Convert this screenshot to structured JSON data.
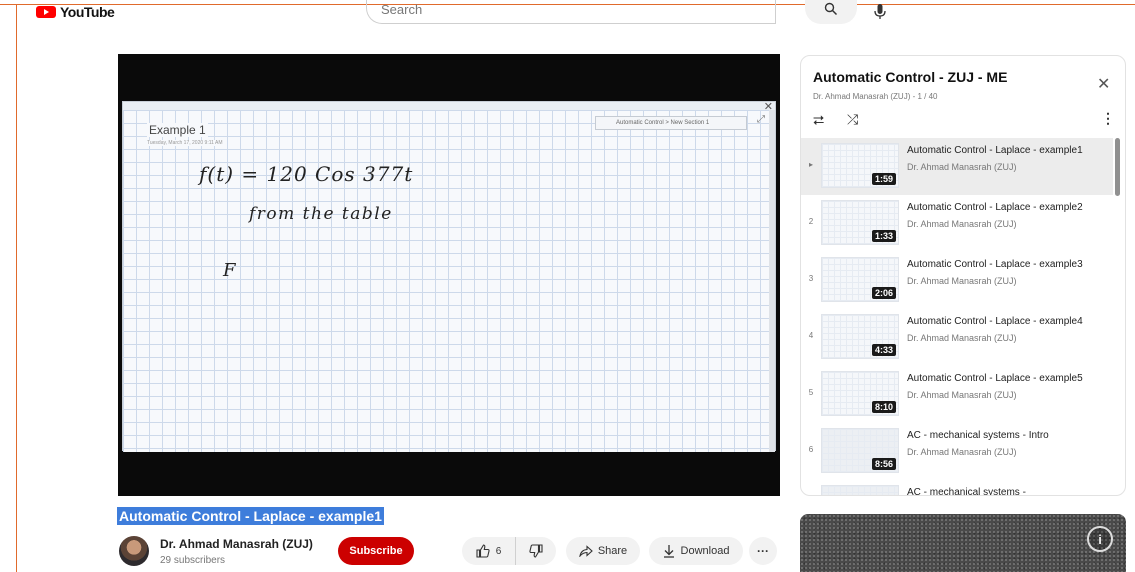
{
  "header": {
    "logo_text": "YouTube",
    "search_placeholder": "Search"
  },
  "player": {
    "note_title": "Example 1",
    "note_date": "Tuesday, March 17, 2020  9:11 AM",
    "section_label": "Automatic Control > New Section 1",
    "handwriting_line1": "f(t) = 120 Cos 377t",
    "handwriting_line2": "from the table",
    "handwriting_line3": "F"
  },
  "video": {
    "title": "Automatic Control - Laplace - example1",
    "channel_name": "Dr. Ahmad Manasrah (ZUJ)",
    "subscribers": "29 subscribers",
    "subscribe_label": "Subscribe",
    "likes": "6",
    "share_label": "Share",
    "download_label": "Download"
  },
  "playlist": {
    "title": "Automatic Control - ZUJ - ME",
    "subtitle": "Dr. Ahmad Manasrah (ZUJ) - 1 / 40",
    "items": [
      {
        "index": "▸",
        "title": "Automatic Control - Laplace - example1",
        "channel": "Dr. Ahmad Manasrah (ZUJ)",
        "duration": "1:59",
        "active": true
      },
      {
        "index": "2",
        "title": "Automatic Control - Laplace - example2",
        "channel": "Dr. Ahmad Manasrah (ZUJ)",
        "duration": "1:33",
        "active": false
      },
      {
        "index": "3",
        "title": "Automatic Control - Laplace - example3",
        "channel": "Dr. Ahmad Manasrah (ZUJ)",
        "duration": "2:06",
        "active": false
      },
      {
        "index": "4",
        "title": "Automatic Control - Laplace - example4",
        "channel": "Dr. Ahmad Manasrah (ZUJ)",
        "duration": "4:33",
        "active": false
      },
      {
        "index": "5",
        "title": "Automatic Control - Laplace - example5",
        "channel": "Dr. Ahmad Manasrah (ZUJ)",
        "duration": "8:10",
        "active": false
      },
      {
        "index": "6",
        "title": "AC - mechanical systems - Intro",
        "channel": "Dr. Ahmad Manasrah (ZUJ)",
        "duration": "8:56",
        "active": false
      },
      {
        "index": "",
        "title": "AC - mechanical systems -",
        "channel": "",
        "duration": "",
        "active": false
      }
    ]
  },
  "icons": {
    "search": "search-icon",
    "mic": "mic-icon",
    "close": "close-icon",
    "loop": "loop-icon",
    "shuffle": "shuffle-icon",
    "menu": "more-vert-icon",
    "like": "thumb-up-icon",
    "dislike": "thumb-down-icon",
    "share": "share-icon",
    "download": "download-icon",
    "info": "info-icon"
  },
  "colors": {
    "brand_red": "#ff0000",
    "subscribe_red": "#cc0000",
    "title_highlight": "#3e7ddb",
    "frame_orange": "#e06a2c"
  }
}
